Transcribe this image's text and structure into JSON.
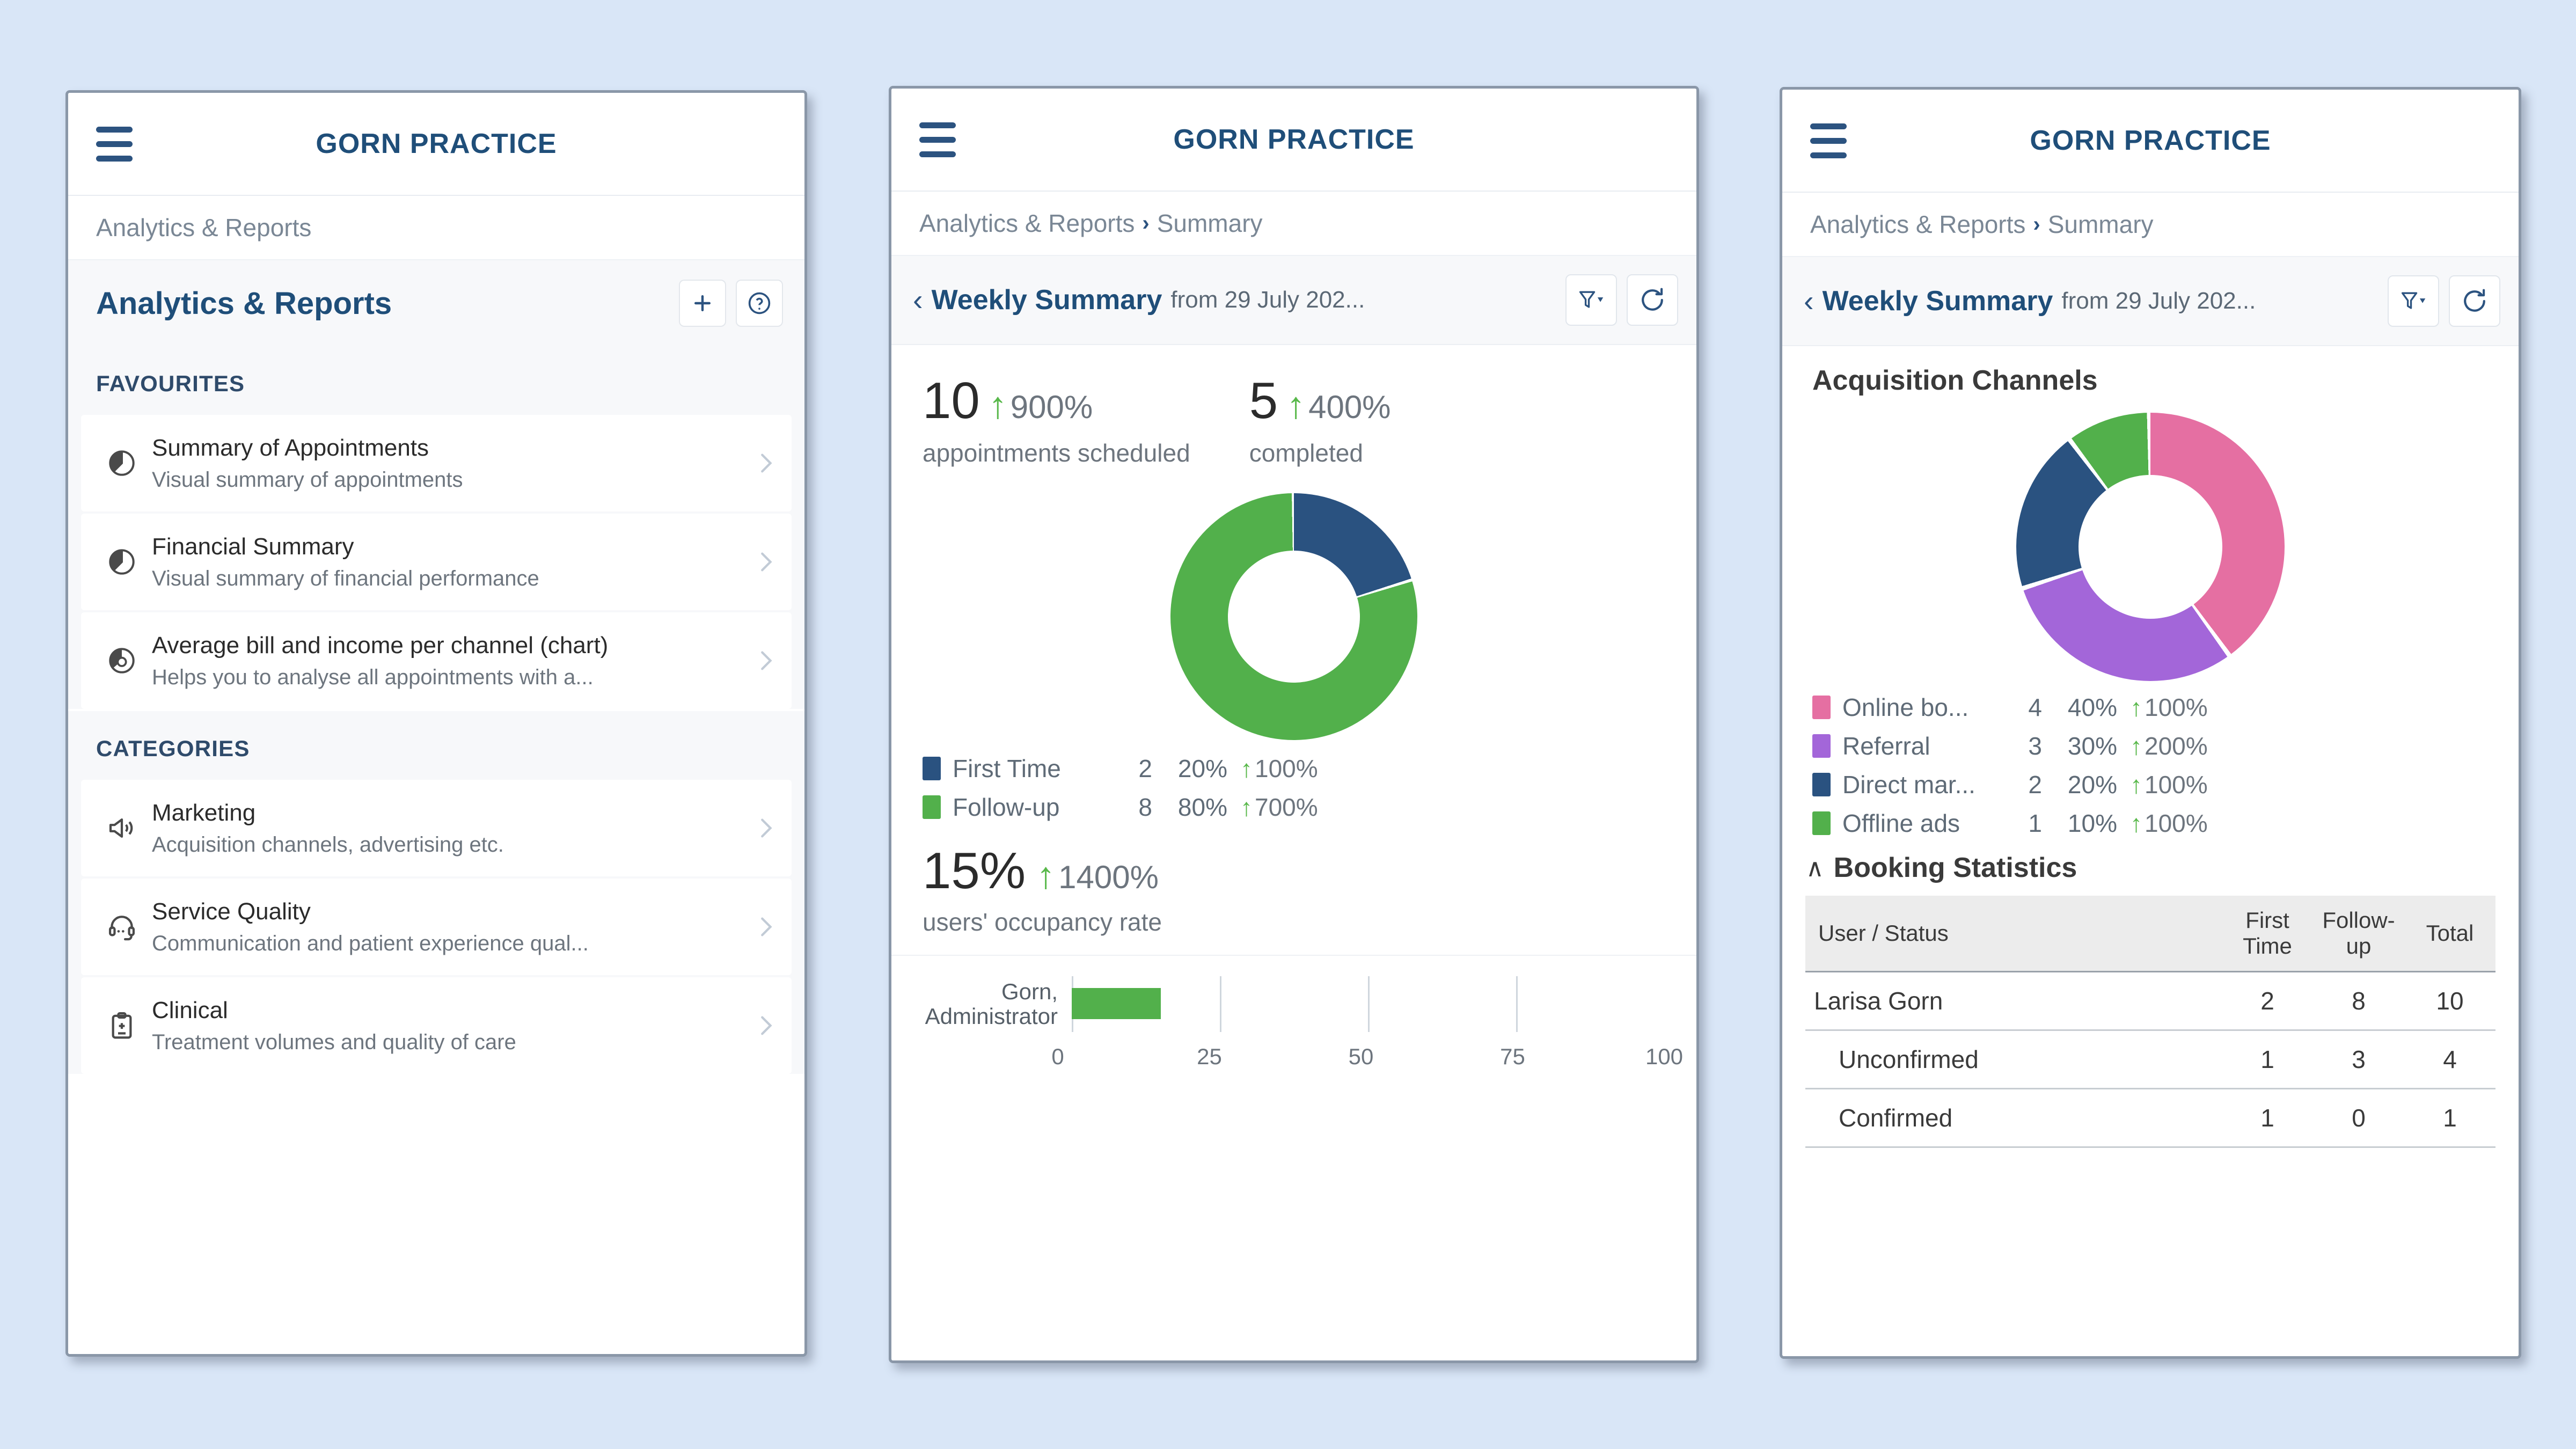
{
  "brand": "GORN PRACTICE",
  "colors": {
    "brand_blue": "#1f4e79",
    "green": "#52b04b",
    "dark_blue": "#2a5280",
    "pink": "#e56fa2",
    "purple": "#a366d9",
    "page_bg": "#d9e6f7"
  },
  "phone1": {
    "breadcrumb": {
      "current": "Analytics & Reports"
    },
    "page_title": "Analytics & Reports",
    "add_button": "+",
    "help_button": "?",
    "favourites_heading": "FAVOURITES",
    "favourites": [
      {
        "icon": "pie-chart-icon",
        "title": "Summary of Appointments",
        "desc": "Visual summary of appointments"
      },
      {
        "icon": "pie-chart-icon",
        "title": "Financial Summary",
        "desc": "Visual summary of financial performance"
      },
      {
        "icon": "donut-chart-icon",
        "title": "Average bill and income per channel (chart)",
        "desc": "Helps you to analyse all appointments with a..."
      }
    ],
    "categories_heading": "CATEGORIES",
    "categories": [
      {
        "icon": "megaphone-icon",
        "title": "Marketing",
        "desc": "Acquisition channels, advertising etc."
      },
      {
        "icon": "headset-icon",
        "title": "Service Quality",
        "desc": "Communication and patient experience qual..."
      },
      {
        "icon": "clipboard-icon",
        "title": "Clinical",
        "desc": "Treatment volumes and quality of care"
      }
    ]
  },
  "phone2": {
    "breadcrumb": {
      "parent": "Analytics & Reports",
      "sep": "›",
      "current": "Summary"
    },
    "report_title": "Weekly Summary",
    "report_subtitle": "from 29 July 202...",
    "back_chevron": "‹",
    "kpis": [
      {
        "value": "10",
        "arrow": "↑",
        "delta": "900%",
        "label": "appointments scheduled"
      },
      {
        "value": "5",
        "arrow": "↑",
        "delta": "400%",
        "label": "completed"
      }
    ],
    "legend": [
      {
        "name": "First Time",
        "count": "2",
        "pct": "20%",
        "arrow": "↑",
        "delta": "100%",
        "color": "#2a5280"
      },
      {
        "name": "Follow-up",
        "count": "8",
        "pct": "80%",
        "arrow": "↑",
        "delta": "700%",
        "color": "#52b04b"
      }
    ],
    "occupancy": {
      "value": "15%",
      "arrow": "↑",
      "delta": "1400%",
      "label": "users' occupancy rate"
    },
    "bar_label_line1": "Gorn,",
    "bar_label_line2": "Administrator",
    "axis_ticks": [
      "0",
      "25",
      "50",
      "75",
      "100"
    ]
  },
  "phone3": {
    "breadcrumb": {
      "parent": "Analytics & Reports",
      "sep": "›",
      "current": "Summary"
    },
    "report_title": "Weekly Summary",
    "report_subtitle": "from 29 July 202...",
    "back_chevron": "‹",
    "section_title": "Acquisition Channels",
    "legend": [
      {
        "name": "Online bo...",
        "count": "4",
        "pct": "40%",
        "arrow": "↑",
        "delta": "100%",
        "color": "#e56fa2"
      },
      {
        "name": "Referral",
        "count": "3",
        "pct": "30%",
        "arrow": "↑",
        "delta": "200%",
        "color": "#a366d9"
      },
      {
        "name": "Direct mar...",
        "count": "2",
        "pct": "20%",
        "arrow": "↑",
        "delta": "100%",
        "color": "#2a5280"
      },
      {
        "name": "Offline ads",
        "count": "1",
        "pct": "10%",
        "arrow": "↑",
        "delta": "100%",
        "color": "#52b04b"
      }
    ],
    "booking_stats": {
      "collapse_caret": "∧",
      "title": "Booking Statistics",
      "columns": [
        "User / Status",
        "First Time",
        "Follow-up",
        "Total"
      ],
      "rows": [
        {
          "label": "Larisa Gorn",
          "indent": false,
          "first_time": "2",
          "follow_up": "8",
          "total": "10"
        },
        {
          "label": "Unconfirmed",
          "indent": true,
          "first_time": "1",
          "follow_up": "3",
          "total": "4"
        },
        {
          "label": "Confirmed",
          "indent": true,
          "first_time": "1",
          "follow_up": "0",
          "total": "1"
        }
      ]
    }
  },
  "chart_data": [
    {
      "type": "pie",
      "title": "Appointment types (Weekly Summary)",
      "labels": [
        "First Time",
        "Follow-up"
      ],
      "values": [
        2,
        8
      ],
      "percentages": [
        20,
        80
      ],
      "colors": [
        "#2a5280",
        "#52b04b"
      ],
      "legend_position": "bottom",
      "donut": true
    },
    {
      "type": "pie",
      "title": "Acquisition Channels",
      "labels": [
        "Online bo...",
        "Referral",
        "Direct mar...",
        "Offline ads"
      ],
      "values": [
        4,
        3,
        2,
        1
      ],
      "percentages": [
        40,
        30,
        20,
        10
      ],
      "colors": [
        "#e56fa2",
        "#a366d9",
        "#2a5280",
        "#52b04b"
      ],
      "legend_position": "bottom",
      "donut": true
    },
    {
      "type": "bar",
      "orientation": "horizontal",
      "title": "users' occupancy rate",
      "categories": [
        "Gorn, Administrator"
      ],
      "values": [
        15
      ],
      "xlabel": "",
      "ylabel": "",
      "xlim": [
        0,
        100
      ],
      "xticks": [
        0,
        25,
        50,
        75,
        100
      ],
      "grid": true,
      "colors": [
        "#52b04b"
      ]
    },
    {
      "type": "table",
      "title": "Booking Statistics",
      "columns": [
        "User / Status",
        "First Time",
        "Follow-up",
        "Total"
      ],
      "rows": [
        [
          "Larisa Gorn",
          2,
          8,
          10
        ],
        [
          "Unconfirmed",
          1,
          3,
          4
        ],
        [
          "Confirmed",
          1,
          0,
          1
        ]
      ]
    }
  ]
}
